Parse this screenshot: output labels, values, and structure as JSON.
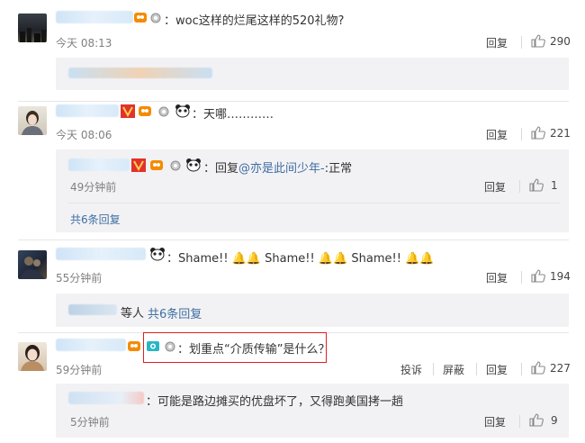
{
  "comments": [
    {
      "text": "：woc这样的烂尾这样的520礼物?",
      "time": "今天 08:13",
      "reply_label": "回复",
      "likes": "290"
    },
    {
      "text": "：天哪…………",
      "time": "今天 08:06",
      "reply_label": "回复",
      "likes": "221",
      "sub_reply": {
        "prefix": "：回复",
        "mention": "@亦是此间少年-",
        "suffix": ":正常",
        "time": "49分钟前",
        "reply_label": "回复",
        "likes": "1"
      },
      "more_label": "共6条回复"
    },
    {
      "text": "：Shame!! 🔔🔔 Shame!! 🔔🔔 Shame!! 🔔🔔",
      "time": "55分钟前",
      "reply_label": "回复",
      "likes": "194",
      "sub_others": "等人",
      "more_label": "共6条回复"
    },
    {
      "text": "：划重点“介质传输”是什么？",
      "time": "59分钟前",
      "report_label": "投诉",
      "block_label": "屏蔽",
      "reply_label": "回复",
      "likes": "227",
      "sub_reply": {
        "text": "：可能是路边摊买的优盘坏了，又得跑美国拷一趟",
        "time": "5分钟前",
        "reply_label": "回复",
        "likes": "9"
      }
    }
  ],
  "colors": {
    "accent_link": "#3f6ea0",
    "highlight_box": "#e02020",
    "subreply_bg": "#f2f2f5"
  }
}
